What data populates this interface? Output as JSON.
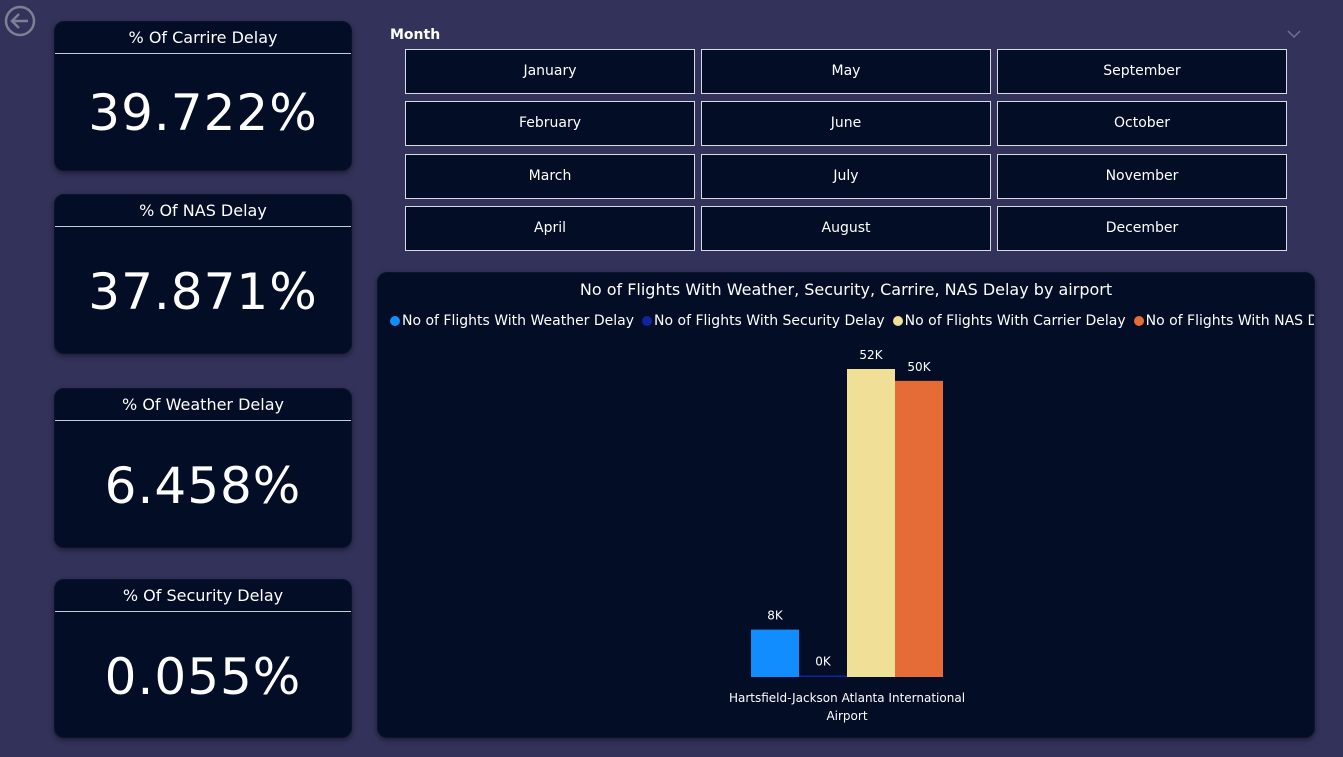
{
  "kpis": [
    {
      "title": "% Of Carrire Delay",
      "value": "39.722%"
    },
    {
      "title": "% Of NAS Delay",
      "value": "37.871%"
    },
    {
      "title": "% Of Weather Delay",
      "value": "6.458%"
    },
    {
      "title": "% Of Security Delay",
      "value": "0.055%"
    }
  ],
  "month_slicer": {
    "label": "Month",
    "months": [
      "January",
      "May",
      "September",
      "February",
      "June",
      "October",
      "March",
      "July",
      "November",
      "April",
      "August",
      "December"
    ]
  },
  "icons": {
    "back": "back-arrow-circle-icon",
    "slicer_menu": "chevron-down-icon"
  },
  "chart_data": {
    "type": "bar",
    "title": "No of Flights With Weather, Security, Carrire, NAS Delay by airport",
    "categories": [
      "Hartsfield-Jackson Atlanta International Airport"
    ],
    "category_label_lines": [
      "Hartsfield-Jackson Atlanta International",
      "Airport"
    ],
    "series": [
      {
        "name": "No of Flights With Weather Delay",
        "values": [
          8000
        ],
        "label": "8K",
        "color": "#118dff"
      },
      {
        "name": "No of Flights With Security Delay",
        "values": [
          30
        ],
        "label": "0K",
        "color": "#12239e"
      },
      {
        "name": "No of Flights With Carrier Delay",
        "values": [
          52000
        ],
        "label": "52K",
        "color": "#f0df97"
      },
      {
        "name": "No of Flights With NAS Delay",
        "values": [
          50000
        ],
        "label": "50K",
        "color": "#e66c37"
      }
    ],
    "ylim": [
      0,
      52000
    ],
    "legend_position": "top-left",
    "grid": false
  },
  "colors": {
    "page_background": "#33325a",
    "card_background": "#030d26",
    "text": "#ffffff"
  }
}
